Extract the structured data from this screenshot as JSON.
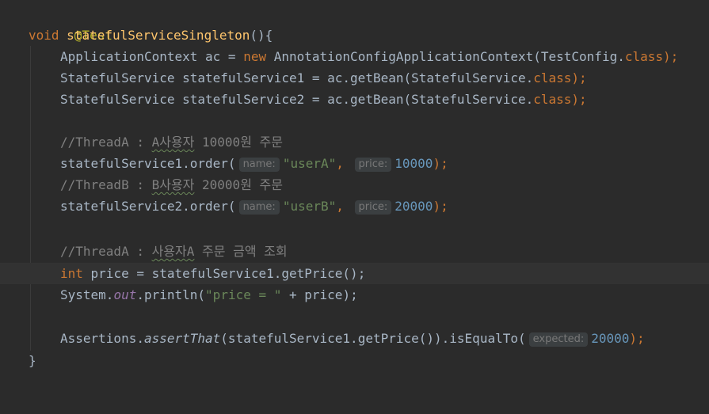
{
  "code": {
    "line01": {
      "annotation": "@Test"
    },
    "line02": {
      "kw_void": "void",
      "method_name": "statefulServiceSingleton",
      "tail": "(){"
    },
    "line03": {
      "decl": "ApplicationContext ac = ",
      "kw_new": "new",
      "ctor": " AnnotationConfigApplicationContext(TestConfig.",
      "kw_class": "class",
      "tail": ");"
    },
    "line04": {
      "decl": "StatefulService statefulService1 = ac.getBean(StatefulService.",
      "kw_class": "class",
      "tail": ");"
    },
    "line05": {
      "decl": "StatefulService statefulService2 = ac.getBean(StatefulService.",
      "kw_class": "class",
      "tail": ");"
    },
    "line07": {
      "comment_a": "//ThreadA : ",
      "comment_b": "A사용자",
      "comment_c": " 10000원 주문"
    },
    "line08": {
      "call": "statefulService1.order(",
      "hint_name": "name:",
      "arg_name": "\"userA\"",
      "sep": ",",
      "hint_price": "price:",
      "arg_price": "10000",
      "tail": ");"
    },
    "line09": {
      "comment_a": "//ThreadB : ",
      "comment_b": "B사용자",
      "comment_c": " 20000원 주문"
    },
    "line10": {
      "call": "statefulService2.order(",
      "hint_name": "name:",
      "arg_name": "\"userB\"",
      "sep": ",",
      "hint_price": "price:",
      "arg_price": "20000",
      "tail": ");"
    },
    "line12": {
      "comment_a": "//ThreadA : ",
      "comment_b": "사용자A",
      "comment_c": " 주문 금액 조회"
    },
    "line13": {
      "kw_int": "int",
      "rest": " price = statefulService1.getPrice();"
    },
    "line14": {
      "system": "System.",
      "out": "out",
      "println": ".println(",
      "str": "\"price = \"",
      "rest": " + price);"
    },
    "line16": {
      "assertions": "Assertions.",
      "assert_that": "assertThat",
      "mid": "(statefulService1.getPrice()).isEqualTo(",
      "hint_expected": "expected:",
      "arg_expected": "20000",
      "tail": ");"
    },
    "line17": {
      "close": "}"
    }
  },
  "colors": {
    "background": "#2b2b2b",
    "current_line": "#323232",
    "text": "#a9b7c6",
    "keyword": "#cc7832",
    "method_declaration": "#ffc66d",
    "annotation": "#bbb529",
    "string": "#6a8759",
    "number": "#6897bb",
    "comment": "#808080",
    "static_field": "#9876aa",
    "inlay_hint_background": "#3b3f41",
    "inlay_hint_text": "#787878"
  }
}
